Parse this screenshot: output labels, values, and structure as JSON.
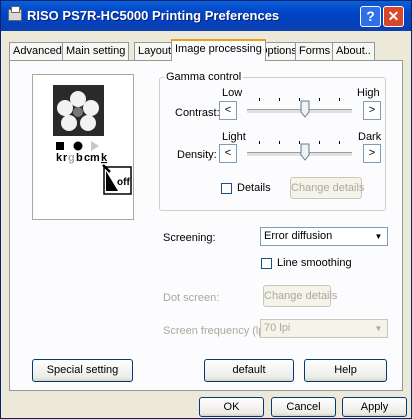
{
  "window": {
    "title": "RISO PS7R-HC5000 Printing Preferences",
    "help_glyph": "?",
    "close_glyph": "✕"
  },
  "tabs": [
    "Advanced",
    "Main setting",
    "Layout",
    "Image processing",
    "Options",
    "Forms",
    "About.."
  ],
  "active_tab": "Image processing",
  "preview": {
    "channels": "krgbcmk",
    "overlay_label": "off"
  },
  "gamma": {
    "group_title": "Gamma control",
    "contrast": {
      "label": "Contrast:",
      "low": "Low",
      "high": "High",
      "left_arrow": "<",
      "right_arrow": ">",
      "level": 0.55
    },
    "density": {
      "label": "Density:",
      "low": "Light",
      "high": "Dark",
      "left_arrow": "<",
      "right_arrow": ">",
      "level": 0.55
    },
    "details_label": "Details",
    "details_checked": false,
    "change_details": "Change details"
  },
  "screening": {
    "label": "Screening:",
    "value": "Error diffusion"
  },
  "line_smoothing": {
    "label": "Line smoothing",
    "checked": false
  },
  "dot_screen": {
    "label": "Dot screen:",
    "button": "Change details"
  },
  "screen_frequency": {
    "label": "Screen frequency (lpi):",
    "value": "70 lpi"
  },
  "buttons": {
    "special": "Special setting",
    "default": "default",
    "help": "Help",
    "ok": "OK",
    "cancel": "Cancel",
    "apply": "Apply"
  }
}
